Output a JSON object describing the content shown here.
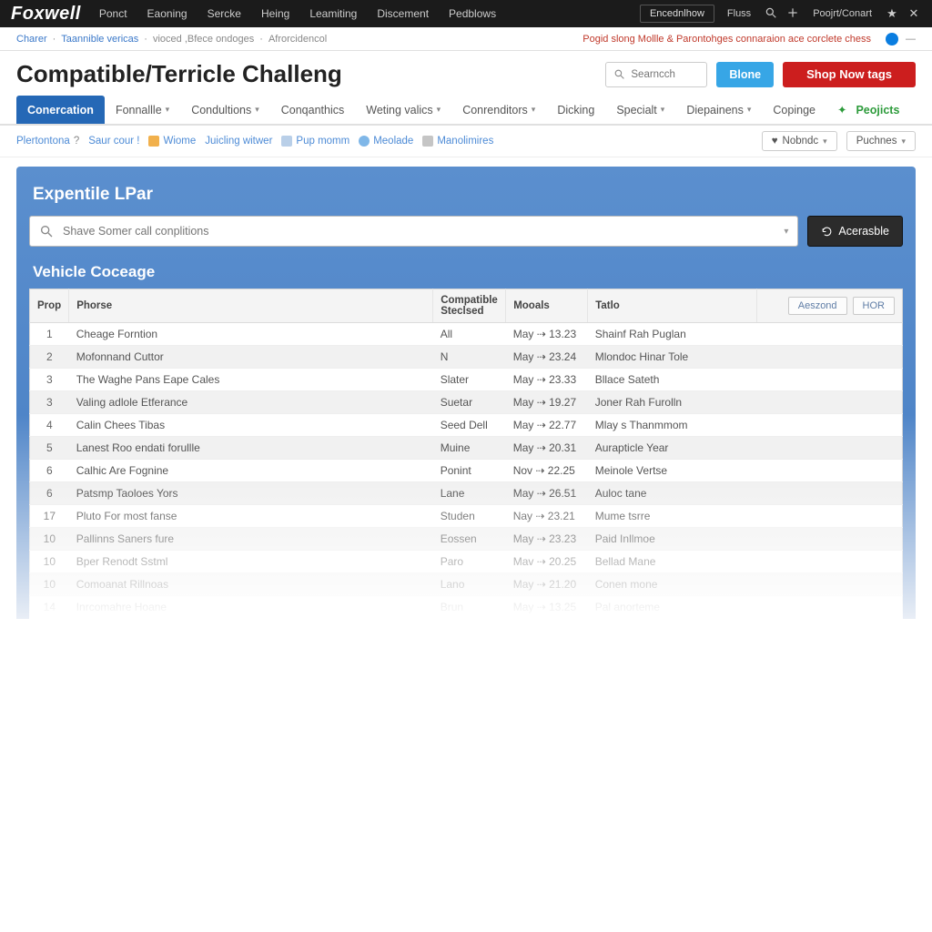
{
  "topbar": {
    "brand": "Foxwell",
    "nav": [
      "Ponct",
      "Eaoning",
      "Sercke",
      "Heing",
      "Leamiting",
      "Discement",
      "Pedblows"
    ],
    "action_btn": "Encednlhow",
    "action_link": "Fluss",
    "right_label": "Poojrt/Conart"
  },
  "crumbs": {
    "items": [
      "Charer",
      "Taannible vericas",
      "vioced ,Bfece ondoges",
      "Afrorcidencol"
    ],
    "notice": "Pogid slong Mollle & Parontohges connaraion ace corclete chess"
  },
  "page": {
    "title": "Compatible/Terricle Challeng",
    "search_placeholder": "Searncch",
    "blue_btn": "Blone",
    "red_btn": "Shop Now tags"
  },
  "tabs": [
    {
      "label": "Conercation",
      "active": true,
      "caret": false
    },
    {
      "label": "Fonnallle",
      "caret": true
    },
    {
      "label": "Condultions",
      "caret": true
    },
    {
      "label": "Conqanthics",
      "caret": false
    },
    {
      "label": "Weting valics",
      "caret": true
    },
    {
      "label": "Conrenditors",
      "caret": true
    },
    {
      "label": "Dicking",
      "caret": false
    },
    {
      "label": "Specialt",
      "caret": true
    },
    {
      "label": "Diepainens",
      "caret": true
    },
    {
      "label": "Copinge",
      "caret": false
    },
    {
      "label": "Peojicts",
      "caret": false,
      "green": true
    }
  ],
  "meta": {
    "items": [
      "Plertontona",
      "Saur cour !",
      "Wiome",
      "Juicling witwer",
      "Pup momm",
      "Meolade",
      "Manolimires"
    ],
    "btn1": "Nobndc",
    "btn2": "Puchnes"
  },
  "panel": {
    "title": "Expentile LPar",
    "search_placeholder": "Shave Somer call conplitions",
    "action_btn": "Acerasble",
    "subtitle": "Vehicle Coceage"
  },
  "table": {
    "headers": {
      "idx": "Prop",
      "name": "Phorse",
      "comp": "Compatible Steclsed",
      "date": "Mooals",
      "title": "Tatlo",
      "btn1": "Aeszond",
      "btn2": "HOR"
    },
    "rows": [
      {
        "idx": "1",
        "name": "Cheage Forntion",
        "comp": "All",
        "date": "May ⇢ 13.23",
        "title": "Shainf Rah Puglan"
      },
      {
        "idx": "2",
        "name": "Mofonnand Cuttor",
        "comp": "N",
        "date": "May ⇢ 23.24",
        "title": "Mlondoc Hinar Tole"
      },
      {
        "idx": "3",
        "name": "The Waghe Pans Eape Cales",
        "comp": "Slater",
        "date": "May ⇢ 23.33",
        "title": "Bllace Sateth"
      },
      {
        "idx": "3",
        "name": "Valing adlole Etferance",
        "comp": "Suetar",
        "date": "May ⇢ 19.27",
        "title": "Joner Rah Furolln"
      },
      {
        "idx": "4",
        "name": "Calin Chees Tibas",
        "comp": "Seed Dell",
        "date": "May ⇢ 22.77",
        "title": "Mlay s Thanmmom"
      },
      {
        "idx": "5",
        "name": "Lanest Roo endati forullle",
        "comp": "Muine",
        "date": "May ⇢ 20.31",
        "title": "Aurapticle Year"
      },
      {
        "idx": "6",
        "name": "Calhic Are Fognine",
        "comp": "Ponint",
        "date": "Nov ⇢ 22.25",
        "title": "Meinole Vertse"
      },
      {
        "idx": "6",
        "name": "Patsmp Taoloes Yors",
        "comp": "Lane",
        "date": "May ⇢ 26.51",
        "title": "Auloc tane"
      },
      {
        "idx": "17",
        "name": "Pluto For most fanse",
        "comp": "Studen",
        "date": "Nay ⇢ 23.21",
        "title": "Mume tsrre"
      },
      {
        "idx": "10",
        "name": "Pallinns Saners fure",
        "comp": "Eossen",
        "date": "May ⇢ 23.23",
        "title": "Paid Inllmoe"
      },
      {
        "idx": "10",
        "name": "Bper Renodt Sstml",
        "comp": "Paro",
        "date": "Mav ⇢ 20.25",
        "title": "Bellad Mane"
      },
      {
        "idx": "10",
        "name": "Comoanat Rillnoas",
        "comp": "Lano",
        "date": "May ⇢ 21.20",
        "title": "Conen mone"
      },
      {
        "idx": "14",
        "name": "Inrcomahre Hoane",
        "comp": "Brun",
        "date": "May ⇢ 13.25",
        "title": "Pal anorteme"
      }
    ]
  }
}
